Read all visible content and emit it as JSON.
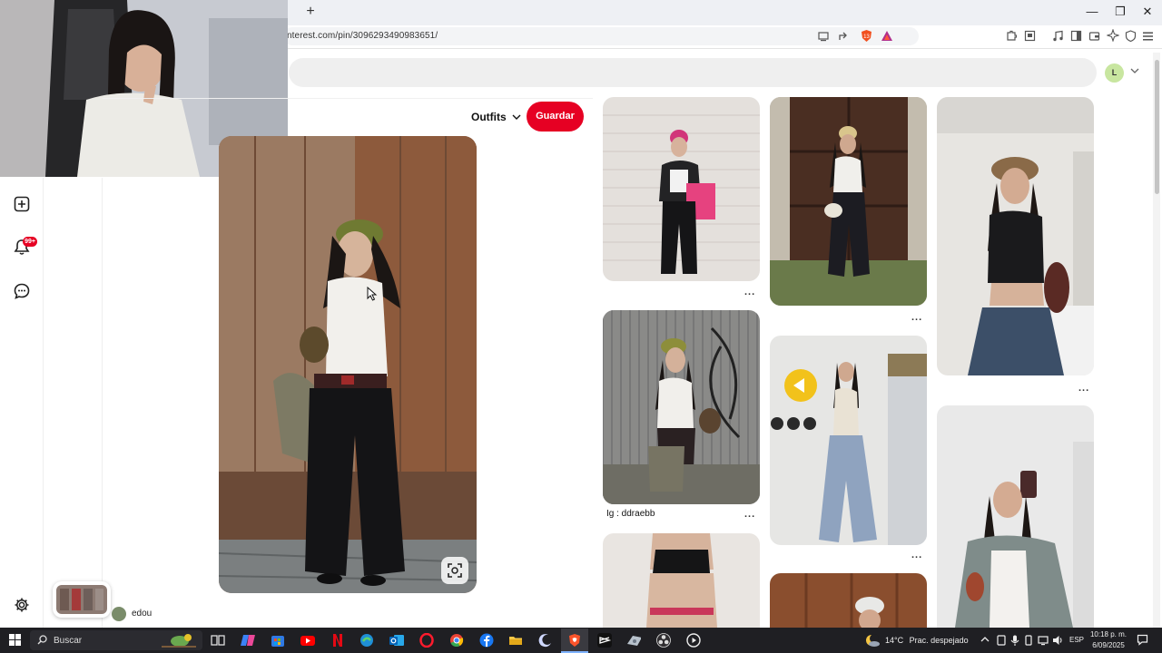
{
  "browser": {
    "new_tab_label": "+",
    "url": "nterest.com/pin/3096293490983651/",
    "window_controls": {
      "minimize": "—",
      "restore": "❐",
      "close": "✕"
    }
  },
  "pinterest": {
    "account_initial": "L",
    "notification_count": "99+",
    "closeup": {
      "board_label": "Outfits",
      "save_label": "Guardar",
      "creator_name": "edou"
    },
    "grid": {
      "more_label": "...",
      "captions": [
        "Ig : ddraebb"
      ]
    }
  },
  "taskbar": {
    "search_label": "Buscar",
    "weather_temp": "14°C",
    "weather_desc": "Prac. despejado",
    "language": "ESP",
    "time": "10:18 p. m.",
    "date": "6/09/2025"
  },
  "colors": {
    "accent": "#e60023",
    "taskbar": "#1f1f23"
  }
}
